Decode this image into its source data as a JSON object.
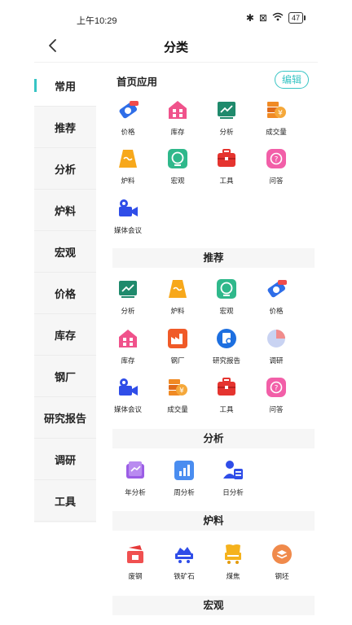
{
  "status": {
    "time": "上午10:29",
    "battery": "47"
  },
  "header": {
    "title": "分类"
  },
  "sidebar": {
    "items": [
      "常用",
      "推荐",
      "分析",
      "炉料",
      "宏观",
      "价格",
      "库存",
      "钢厂",
      "研究报告",
      "调研",
      "工具"
    ]
  },
  "home": {
    "label": "首页应用",
    "edit": "编辑"
  },
  "sections": {
    "recommend": "推荐",
    "analysis": "分析",
    "burden": "炉料",
    "macro": "宏观"
  },
  "apps": {
    "home": [
      "价格",
      "库存",
      "分析",
      "成交量",
      "炉料",
      "宏观",
      "工具",
      "问答",
      "媒体会议"
    ],
    "recommend": [
      "分析",
      "炉料",
      "宏观",
      "价格",
      "库存",
      "钢厂",
      "研究报告",
      "调研",
      "媒体会议",
      "成交量",
      "工具",
      "问答"
    ],
    "analysis": [
      "年分析",
      "周分析",
      "日分析"
    ],
    "burden": [
      "废钢",
      "铁矿石",
      "煤焦",
      "钢坯"
    ]
  },
  "colors": {
    "accent": "#37c4c4",
    "sidebar_bg": "#f6f6f6"
  }
}
